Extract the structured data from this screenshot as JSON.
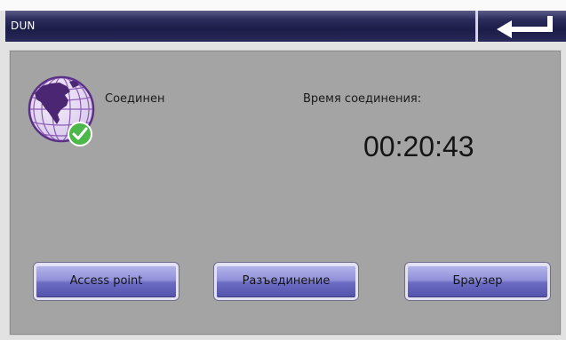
{
  "titlebar": {
    "title": "DUN",
    "back_icon": "return-arrow-icon"
  },
  "status": {
    "icon": "globe-icon",
    "badge_icon": "checkmark-icon",
    "label": "Соединен"
  },
  "timer": {
    "label": "Время соединения:",
    "value": "00:20:43"
  },
  "buttons": [
    {
      "label": "Access point"
    },
    {
      "label": "Разъединение"
    },
    {
      "label": "Браузер"
    }
  ],
  "colors": {
    "title_bar": "#1c1c48",
    "panel": "#a4a4a4",
    "button": "#6c6cc4",
    "badge": "#4cb84a",
    "globe": "#5a2f86"
  }
}
